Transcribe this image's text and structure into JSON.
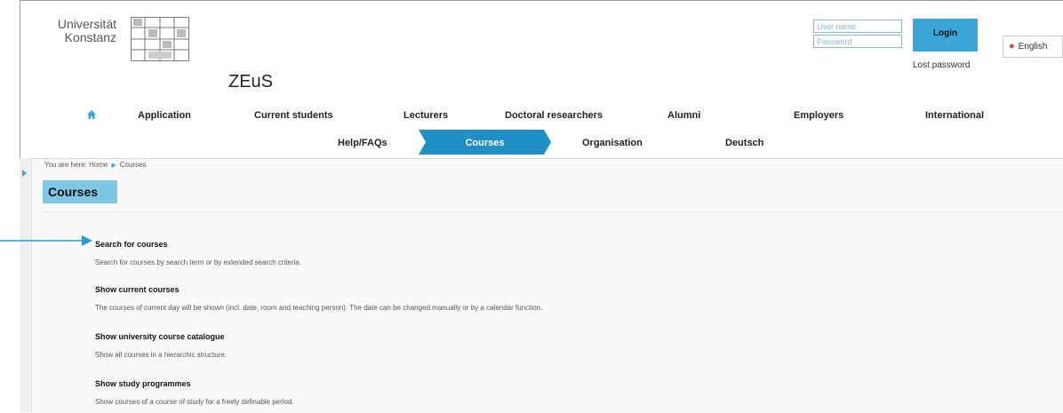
{
  "brand": {
    "university_line1": "Universität",
    "university_line2": "Konstanz",
    "app_name": "ZEuS"
  },
  "login": {
    "username_placeholder": "User name",
    "password_placeholder": "Password",
    "login_label": "Login",
    "lost_password": "Lost password",
    "language": "English"
  },
  "nav_primary": [
    {
      "label": "Application"
    },
    {
      "label": "Current students"
    },
    {
      "label": "Lecturers"
    },
    {
      "label": "Doctoral researchers"
    },
    {
      "label": "Alumni"
    },
    {
      "label": "Employers"
    },
    {
      "label": "International"
    }
  ],
  "nav_secondary": [
    {
      "label": "Help/FAQs"
    },
    {
      "label": "Courses",
      "active": true
    },
    {
      "label": "Organisation"
    },
    {
      "label": "Deutsch"
    }
  ],
  "breadcrumb": {
    "prefix": "You are here:",
    "home": "Home",
    "current": "Courses"
  },
  "page_title": "Courses",
  "entries": [
    {
      "title": "Search for courses",
      "description": "Search for courses by search term or by extended search criteria."
    },
    {
      "title": "Show current courses",
      "description": "The courses of current day will be shown (incl. date, room and teaching person). The date can be changed manually or by a calendar function."
    },
    {
      "title": "Show university course catalogue",
      "description": "Show all courses in a hierarchic structure."
    },
    {
      "title": "Show study programmes",
      "description": "Show courses of a course of study for a freely definable period."
    }
  ],
  "colors": {
    "accent": "#3aa6d6",
    "title_highlight": "#7fc6e4",
    "language_dot": "#e0453a"
  },
  "icons": [
    "home-icon",
    "chevron-right-icon",
    "callout-arrow-icon"
  ]
}
